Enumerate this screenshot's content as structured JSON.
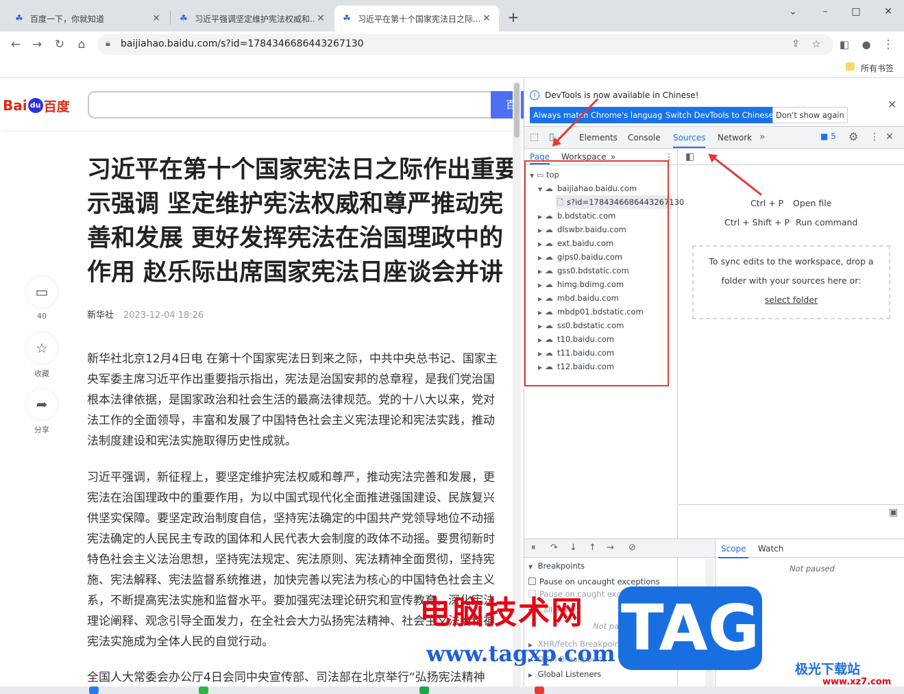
{
  "browser": {
    "tabs": [
      {
        "title": "百度一下，你就知道"
      },
      {
        "title": "习近平强调坚定维护宪法权威和..."
      },
      {
        "title": "习近平在第十个国家宪法日之际..."
      }
    ],
    "url": "baijiahao.baidu.com/s?id=1784346686443267130",
    "bookmarks_label": "所有书签"
  },
  "page": {
    "logo": {
      "left": "Bai",
      "paw": "du",
      "right": "百度"
    },
    "search_button": "百",
    "title_lines": [
      "习近平在第十个国家宪法日之际作出重要",
      "示强调 坚定维护宪法权威和尊严推动宪",
      "善和发展 更好发挥宪法在治国理政中的",
      "作用 赵乐际出席国家宪法日座谈会并讲"
    ],
    "source": "新华社",
    "date": "2023-12-04 18:26",
    "sidebar": {
      "comment_count": "40",
      "favorite": "收藏",
      "share": "分享"
    },
    "paragraph1": [
      "新华社北京12月4日电 在第十个国家宪法日到来之际，中共中央总书记、国家主",
      "央军委主席习近平作出重要指示指出，宪法是治国安邦的总章程，是我们党治国",
      "根本法律依据，是国家政治和社会生活的最高法律规范。党的十八大以来，党对",
      "法工作的全面领导，丰富和发展了中国特色社会主义宪法理论和宪法实践，推动",
      "法制度建设和宪法实施取得历史性成就。"
    ],
    "paragraph2": [
      "习近平强调，新征程上，要坚定维护宪法权威和尊严，推动宪法完善和发展，更",
      "宪法在治国理政中的重要作用，为以中国式现代化全面推进强国建设、民族复兴",
      "供坚实保障。要坚定政治制度自信，坚持宪法确定的中国共产党领导地位不动摇",
      "宪法确定的人民民主专政的国体和人民代表大会制度的政体不动摇。要贯彻新时",
      "特色社会主义法治思想，坚持宪法规定、宪法原则、宪法精神全面贯彻，坚持宪",
      "施、宪法解释、宪法监督系统推进，加快完善以宪法为核心的中国特色社会主义",
      "系，不断提高宪法实施和监督水平。要加强宪法理论研究和宣传教育，深化宪法",
      "理论阐释、观念引导全面发力，在全社会大力弘扬宪法精神、社会主义法治精神",
      "宪法实施成为全体人民的自觉行动。"
    ],
    "paragraph3": "全国人大常委会办公厅4日会同中央宣传部、司法部在北京举行“弘扬宪法精神"
  },
  "devtools": {
    "banner": {
      "message": "DevTools is now available in Chinese!",
      "btn_match": "Always match Chrome's language",
      "btn_switch": "Switch DevTools to Chinese",
      "btn_dismiss": "Don't show again"
    },
    "tabs": [
      "Elements",
      "Console",
      "Sources",
      "Network"
    ],
    "issues_count": "5",
    "nav_tabs": [
      "Page",
      "Workspace"
    ],
    "tree_top": "top",
    "tree_main": "baijiahao.baidu.com",
    "tree_file": "s?id=1784346686443267130",
    "domains": [
      "b.bdstatic.com",
      "dlswbr.baidu.com",
      "ext.baidu.com",
      "gips0.baidu.com",
      "gss0.bdstatic.com",
      "himg.bdimg.com",
      "mbd.baidu.com",
      "mbdp01.bdstatic.com",
      "ss0.bdstatic.com",
      "t10.baidu.com",
      "t11.baidu.com",
      "t12.baidu.com"
    ],
    "shortcuts": [
      {
        "keys": "Ctrl + P",
        "label": "Open file"
      },
      {
        "keys": "Ctrl + Shift + P",
        "label": "Run command"
      }
    ],
    "workspace_text1": "To sync edits to the workspace, drop a",
    "workspace_text2": "folder with your sources here or:",
    "select_folder": "select folder",
    "breakpoints": "Breakpoints",
    "pause_uncaught": "Pause on uncaught exceptions",
    "pause_caught": "Pause on caught exceptions",
    "call_stack": "Call Stack",
    "not_paused": "Not paused",
    "xhr": "XHR/fetch Breakpoints",
    "dom_bp": "DOM Breakpoints",
    "global": "Global Listeners",
    "scope": "Scope",
    "watch": "Watch"
  },
  "watermark": {
    "site_cn": "电脑技术网",
    "site_url": "www.tagxp.com",
    "tag": "TAG",
    "brand": "极光下载站",
    "brand_url": "www.xz7.com"
  }
}
